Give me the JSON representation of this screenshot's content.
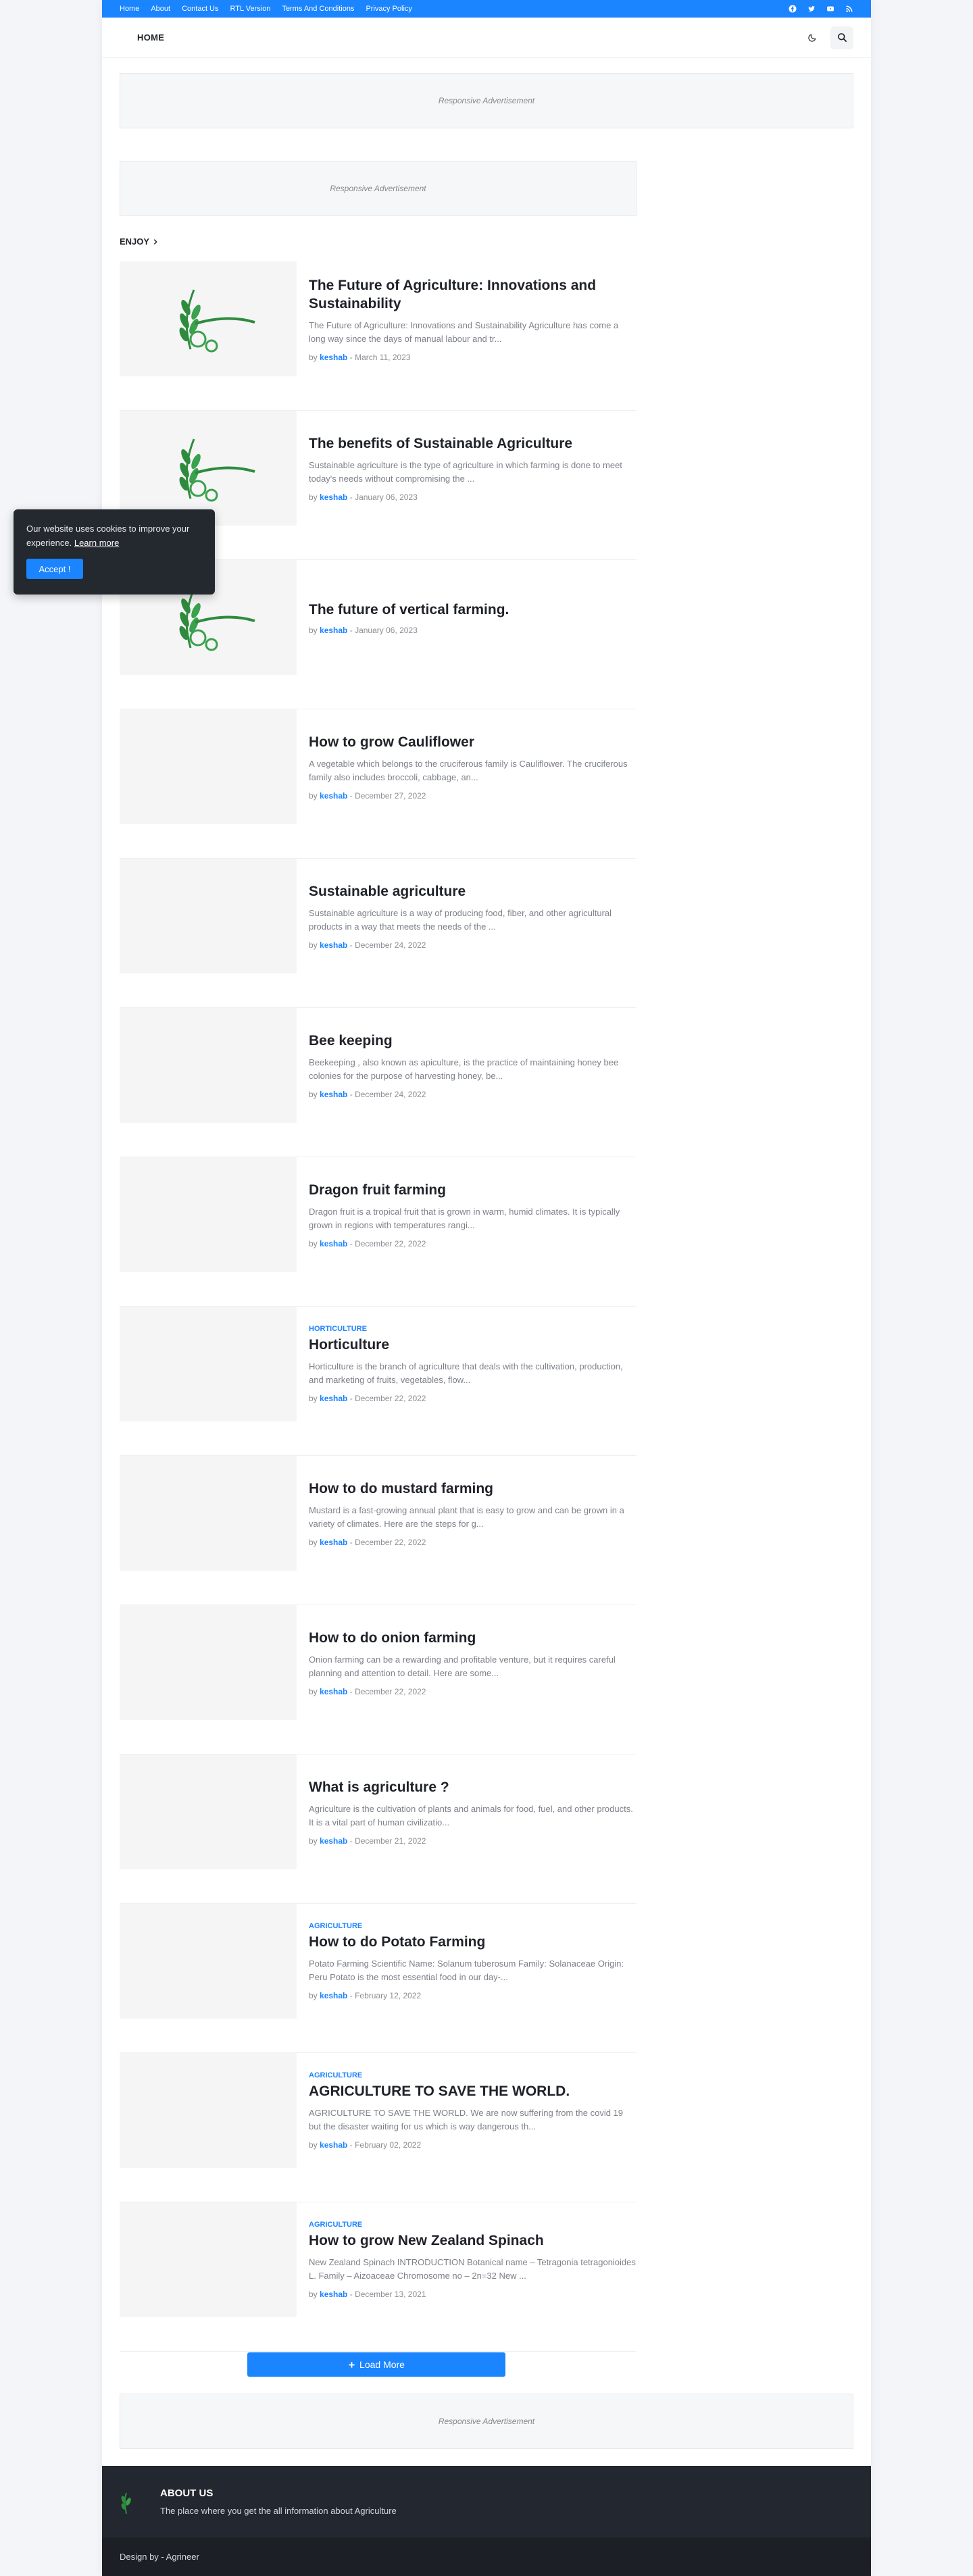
{
  "topbar": {
    "links": [
      "Home",
      "About",
      "Contact Us",
      "RTL Version",
      "Terms And Conditions",
      "Privacy Policy"
    ],
    "social_icons": [
      "facebook-icon",
      "twitter-icon",
      "youtube-icon",
      "rss-icon"
    ]
  },
  "header": {
    "nav_home": "HOME"
  },
  "ads": {
    "label": "Responsive Advertisement"
  },
  "section": {
    "title": "ENJOY"
  },
  "posts": [
    {
      "category": "",
      "title": "The Future of Agriculture: Innovations and Sustainability",
      "excerpt": "The Future of Agriculture: Innovations and Sustainability Agriculture has come a long way since the days of manual labour and tr...",
      "by": "by",
      "author": "keshab",
      "date": "March 11, 2023",
      "has_logo": true
    },
    {
      "category": "",
      "title": "The benefits of Sustainable Agriculture",
      "excerpt": "Sustainable agriculture is the type of agriculture in which farming is done to meet today's needs without compromising the ...",
      "by": "by",
      "author": "keshab",
      "date": "January 06, 2023",
      "has_logo": true
    },
    {
      "category": "",
      "title": "The future of vertical farming.",
      "excerpt": "",
      "by": "by",
      "author": "keshab",
      "date": "January 06, 2023",
      "has_logo": true
    },
    {
      "category": "",
      "title": "How to grow Cauliflower",
      "excerpt": "A vegetable which belongs to the cruciferous family is Cauliflower. The cruciferous family also includes broccoli, cabbage, an...",
      "by": "by",
      "author": "keshab",
      "date": "December 27, 2022",
      "has_logo": false
    },
    {
      "category": "",
      "title": "Sustainable agriculture",
      "excerpt": "Sustainable agriculture is a way of producing food, fiber, and other agricultural products in a way that meets the needs of the ...",
      "by": "by",
      "author": "keshab",
      "date": "December 24, 2022",
      "has_logo": false
    },
    {
      "category": "",
      "title": "Bee keeping",
      "excerpt": "Beekeeping , also known as apiculture, is the practice of maintaining honey bee colonies for the purpose of harvesting honey, be...",
      "by": "by",
      "author": "keshab",
      "date": "December 24, 2022",
      "has_logo": false
    },
    {
      "category": "",
      "title": "Dragon fruit farming",
      "excerpt": "Dragon fruit is a tropical fruit that is grown in warm, humid climates. It is typically grown in regions with temperatures rangi...",
      "by": "by",
      "author": "keshab",
      "date": "December 22, 2022",
      "has_logo": false
    },
    {
      "category": "HORTICULTURE",
      "title": "Horticulture",
      "excerpt": "Horticulture is the branch of agriculture that deals with the cultivation, production, and marketing of fruits, vegetables, flow...",
      "by": "by",
      "author": "keshab",
      "date": "December 22, 2022",
      "has_logo": false
    },
    {
      "category": "",
      "title": "How to do mustard farming",
      "excerpt": "Mustard is a fast-growing annual plant that is easy to grow and can be grown in a variety of climates. Here are the steps for g...",
      "by": "by",
      "author": "keshab",
      "date": "December 22, 2022",
      "has_logo": false
    },
    {
      "category": "",
      "title": "How to do onion farming",
      "excerpt": "Onion farming can be a rewarding and profitable venture, but it requires careful planning and attention to detail. Here are some...",
      "by": "by",
      "author": "keshab",
      "date": "December 22, 2022",
      "has_logo": false
    },
    {
      "category": "",
      "title": "What is agriculture ?",
      "excerpt": "Agriculture is the cultivation of plants and animals for food, fuel, and other products. It is a vital part of human civilizatio...",
      "by": "by",
      "author": "keshab",
      "date": "December 21, 2022",
      "has_logo": false
    },
    {
      "category": "AGRICULTURE",
      "title": "How to do Potato Farming",
      "excerpt": "Potato Farming Scientific Name: Solanum tuberosum Family: Solanaceae Origin: Peru Potato is the most essential food in our day-...",
      "by": "by",
      "author": "keshab",
      "date": "February 12, 2022",
      "has_logo": false
    },
    {
      "category": "AGRICULTURE",
      "title": "AGRICULTURE TO SAVE THE WORLD.",
      "excerpt": "AGRICULTURE TO SAVE THE WORLD. We are now suffering from the covid 19 but the disaster waiting for us which is way dangerous th...",
      "by": "by",
      "author": "keshab",
      "date": "February 02, 2022",
      "has_logo": false
    },
    {
      "category": "AGRICULTURE",
      "title": "How to grow New Zealand Spinach",
      "excerpt": "New Zealand Spinach INTRODUCTION Botanical name – Tetragonia tetragonioides L. Family – Aizoaceae Chromosome no – 2n=32 New ...",
      "by": "by",
      "author": "keshab",
      "date": "December 13, 2021",
      "has_logo": false
    }
  ],
  "loadmore": {
    "label": "Load More",
    "icon": "plus-icon"
  },
  "footer": {
    "heading": "ABOUT US",
    "text": "The place where you get the all information about Agriculture",
    "credit": "Design by - Agrineer"
  },
  "cookie": {
    "message": "Our website uses cookies to improve your experience.",
    "learn_more": "Learn more",
    "accept": "Accept !"
  },
  "colors": {
    "accent": "#1b84ff",
    "footer_bg": "#23272f",
    "logo_green": "#2e8b3e"
  }
}
